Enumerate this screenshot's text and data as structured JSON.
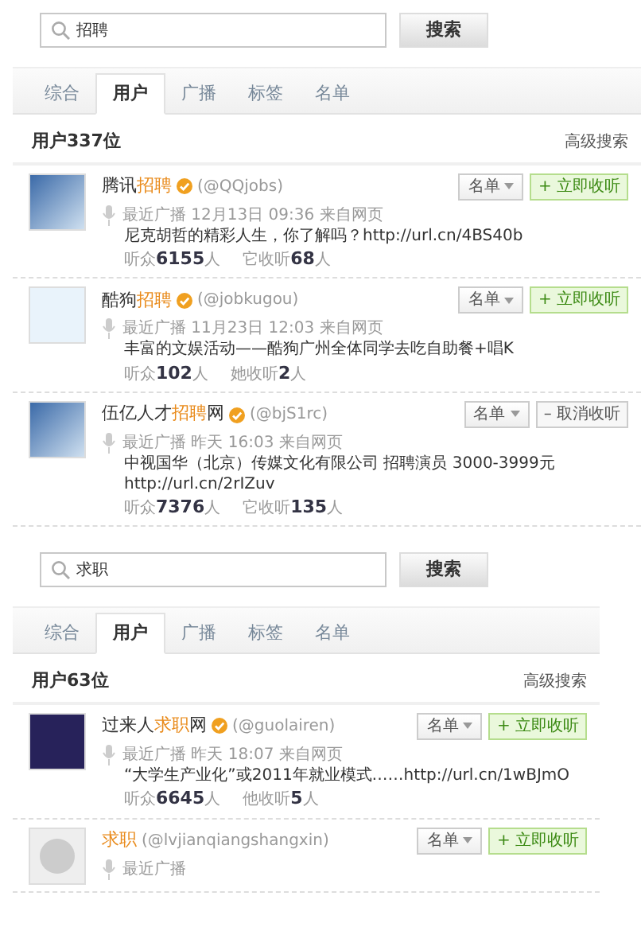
{
  "sections": [
    {
      "search": {
        "value": "招聘",
        "button": "搜索"
      },
      "tabs": [
        {
          "label": "综合",
          "selected": false
        },
        {
          "label": "用户",
          "selected": true
        },
        {
          "label": "广播",
          "selected": false
        },
        {
          "label": "标签",
          "selected": false
        },
        {
          "label": "名单",
          "selected": false
        }
      ],
      "header": {
        "title": "用户337位",
        "link": "高级搜索"
      },
      "users": [
        {
          "avatar": {
            "kind": "image"
          },
          "name_parts": [
            {
              "text": "腾讯",
              "highlight": false
            },
            {
              "text": "招聘",
              "highlight": true
            }
          ],
          "verified": true,
          "handle": "(@QQjobs)",
          "list_button": "名单",
          "follow_button": {
            "kind": "follow",
            "label": "+ 立即收听"
          },
          "meta": "最近广播 12月13日 09:36 来自网页",
          "post": "尼克胡哲的精彩人生，你了解吗？http://url.cn/4BS40b",
          "stats": [
            {
              "label": "听众",
              "value": "6155",
              "unit": "人"
            },
            {
              "label": "它收听",
              "value": "68",
              "unit": "人"
            }
          ]
        },
        {
          "avatar": {
            "kind": "logo"
          },
          "name_parts": [
            {
              "text": "酷狗",
              "highlight": false
            },
            {
              "text": "招聘",
              "highlight": true
            }
          ],
          "verified": true,
          "handle": "(@jobkugou)",
          "list_button": "名单",
          "follow_button": {
            "kind": "follow",
            "label": "+ 立即收听"
          },
          "meta": "最近广播 11月23日 12:03 来自网页",
          "post": "丰富的文娱活动——酷狗广州全体同学去吃自助餐+唱K",
          "stats": [
            {
              "label": "听众",
              "value": "102",
              "unit": "人"
            },
            {
              "label": "她收听",
              "value": "2",
              "unit": "人"
            }
          ]
        },
        {
          "avatar": {
            "kind": "image"
          },
          "name_parts": [
            {
              "text": "伍亿人才",
              "highlight": false
            },
            {
              "text": "招聘",
              "highlight": true
            },
            {
              "text": "网",
              "highlight": false
            }
          ],
          "verified": true,
          "handle": "(@bjS1rc)",
          "list_button": "名单",
          "follow_button": {
            "kind": "unfollow",
            "label": "– 取消收听"
          },
          "meta": "最近广播 昨天 16:03 来自网页",
          "post": "中视国华（北京）传媒文化有限公司 招聘演员 3000-3999元http://url.cn/2rIZuv",
          "stats": [
            {
              "label": "听众",
              "value": "7376",
              "unit": "人"
            },
            {
              "label": "它收听",
              "value": "135",
              "unit": "人"
            }
          ]
        }
      ]
    },
    {
      "search": {
        "value": "求职",
        "button": "搜索"
      },
      "tabs": [
        {
          "label": "综合",
          "selected": false
        },
        {
          "label": "用户",
          "selected": true
        },
        {
          "label": "广播",
          "selected": false
        },
        {
          "label": "标签",
          "selected": false
        },
        {
          "label": "名单",
          "selected": false
        }
      ],
      "header": {
        "title": "用户63位",
        "link": "高级搜索"
      },
      "users": [
        {
          "avatar": {
            "kind": "logo-dark"
          },
          "name_parts": [
            {
              "text": "过来人",
              "highlight": false
            },
            {
              "text": "求职",
              "highlight": true
            },
            {
              "text": "网",
              "highlight": false
            }
          ],
          "verified": true,
          "handle": "(@guolairen)",
          "list_button": "名单",
          "follow_button": {
            "kind": "follow",
            "label": "+ 立即收听"
          },
          "meta": "最近广播 昨天 18:07 来自网页",
          "post": "“大学生产业化”或2011年就业模式……http://url.cn/1wBJmO",
          "stats": [
            {
              "label": "听众",
              "value": "6645",
              "unit": "人"
            },
            {
              "label": "他收听",
              "value": "5",
              "unit": "人"
            }
          ]
        },
        {
          "avatar": {
            "kind": "default"
          },
          "name_parts": [
            {
              "text": "求职",
              "highlight": true
            }
          ],
          "verified": false,
          "handle": "(@lvjianqiangshangxin)",
          "list_button": "名单",
          "follow_button": {
            "kind": "follow",
            "label": "+ 立即收听"
          },
          "meta": "最近广播"
        }
      ]
    }
  ]
}
